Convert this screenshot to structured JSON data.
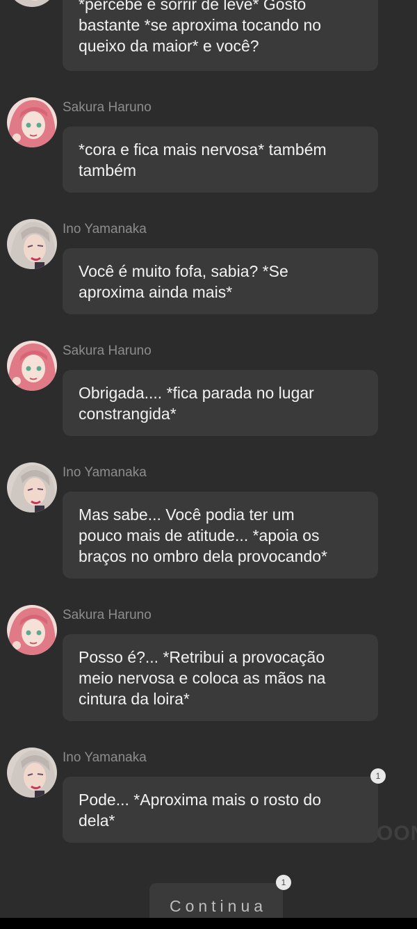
{
  "messages": [
    {
      "author": "",
      "text": "*percebe e sorrir de leve* Gosto\nbastante *se aproxima tocando no\nqueixo da maior* e você?"
    },
    {
      "author": "Sakura Haruno",
      "avatar": "sakura-avatar",
      "text": "*cora e fica mais nervosa* também\ntambém"
    },
    {
      "author": "Ino Yamanaka",
      "avatar": "ino-avatar",
      "text": "Você é muito fofa, sabia? *Se\naproxima ainda mais*"
    },
    {
      "author": "Sakura Haruno",
      "avatar": "sakura-avatar",
      "text": "Obrigada.... *fica parada no lugar\nconstrangida*"
    },
    {
      "author": "Ino Yamanaka",
      "avatar": "ino-avatar",
      "text": "Mas sabe... Você podia ter um\npouco mais de atitude... *apoia os\nbraços no ombro dela provocando*"
    },
    {
      "author": "Sakura Haruno",
      "avatar": "sakura-avatar",
      "text": "Posso é?... *Retribui a provocação\nmeio nervosa e coloca as mãos na\ncintura da loira*"
    },
    {
      "author": "Ino Yamanaka",
      "avatar": "ino-avatar",
      "text": "Pode... *Aproxima mais o rosto do\ndela*",
      "badge": "1"
    }
  ],
  "continue_button": {
    "label": "Continua",
    "badge": "1"
  },
  "watermark": "OON",
  "colors": {
    "background": "#2c2c2c",
    "bubble": "#3a3a3a",
    "author_text": "#8d8d8d",
    "message_text": "#f2f2f2",
    "sakura_hair": "#e07a86",
    "ino_hair": "#ddd6d2"
  }
}
